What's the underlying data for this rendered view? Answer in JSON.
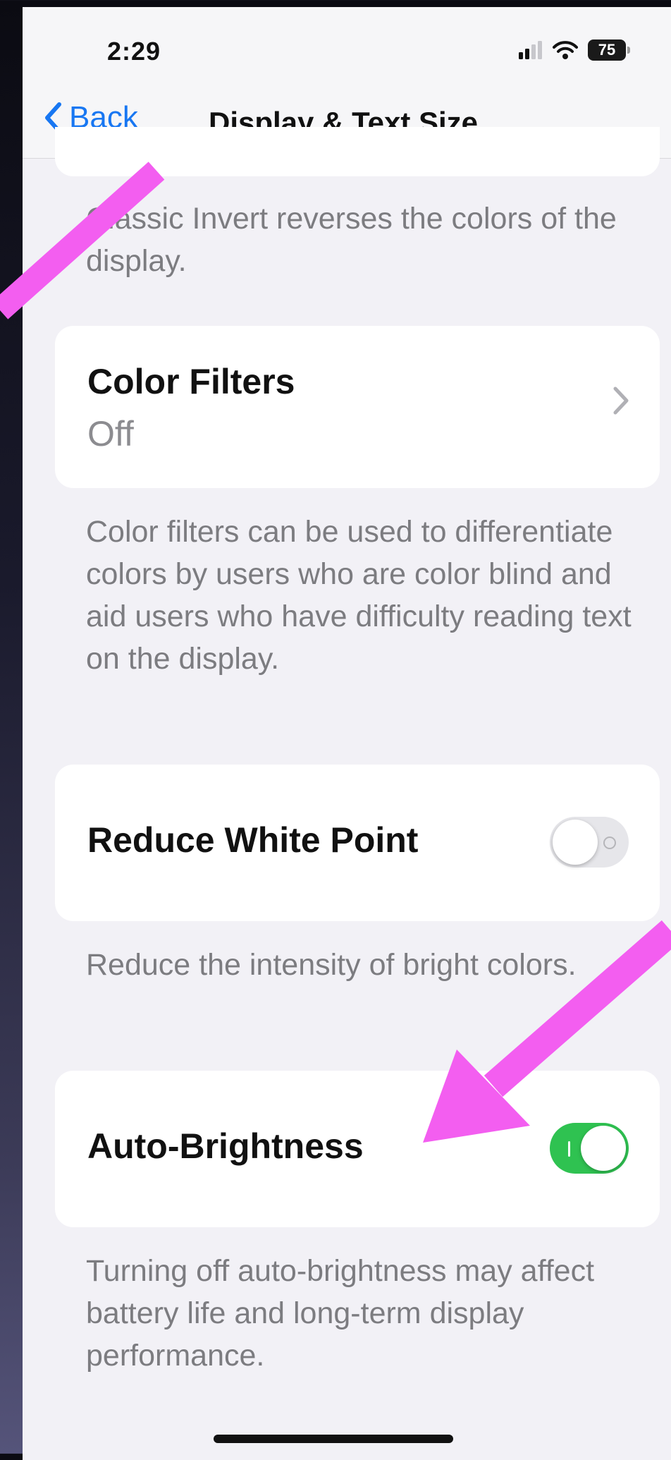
{
  "status_bar": {
    "time": "2:29",
    "battery": "75"
  },
  "nav": {
    "back_label": "Back",
    "title": "Display & Text Size"
  },
  "sections": {
    "classic_invert_footer": "Classic Invert reverses the colors of the display.",
    "color_filters": {
      "title": "Color Filters",
      "value": "Off",
      "footer": "Color filters can be used to differentiate colors by users who are color blind and aid users who have difficulty reading text on the display."
    },
    "reduce_white_point": {
      "title": "Reduce White Point",
      "toggle_state": "off",
      "footer": "Reduce the intensity of bright colors."
    },
    "auto_brightness": {
      "title": "Auto-Brightness",
      "toggle_state": "on",
      "footer": "Turning off auto-brightness may affect battery life and long-term display performance."
    }
  },
  "colors": {
    "accent": "#1877f2",
    "toggle_on": "#2fc251",
    "annotation_arrow": "#f35ef0"
  },
  "annotations": [
    "arrow-pointing-to-back-button",
    "arrow-pointing-to-auto-brightness"
  ]
}
